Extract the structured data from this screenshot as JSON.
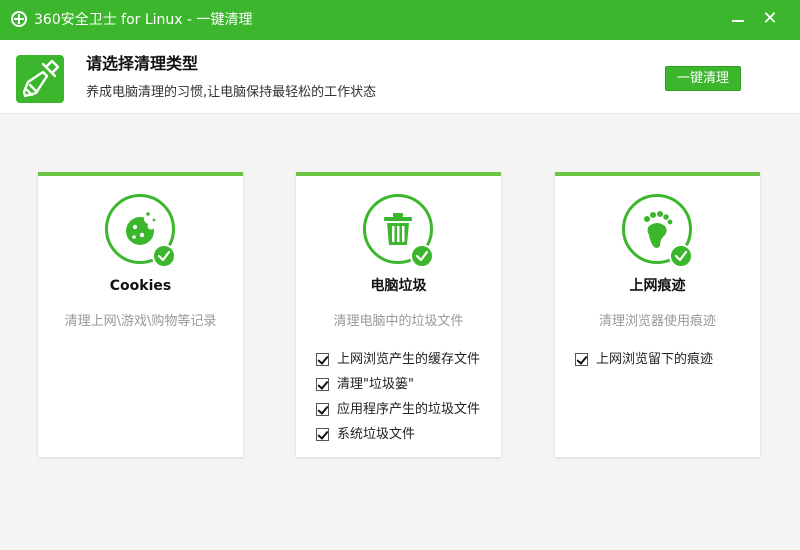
{
  "window": {
    "title": "360安全卫士 for Linux - 一键清理",
    "minimize_glyph": "—",
    "close_glyph": "✕"
  },
  "header": {
    "heading": "请选择清理类型",
    "subtitle": "养成电脑清理的习惯,让电脑保持最轻松的工作状态",
    "clean_button": "一键清理",
    "icon": "broom-icon"
  },
  "colors": {
    "accent": "#3cb62d",
    "card_top": "#6cc241",
    "desc_gray": "#999999"
  },
  "cards": [
    {
      "title": "Cookies",
      "description": "清理上网\\游戏\\购物等记录",
      "icon": "cookie-icon",
      "checked": true,
      "options": []
    },
    {
      "title": "电脑垃圾",
      "description": "清理电脑中的垃圾文件",
      "icon": "trash-icon",
      "checked": true,
      "options": [
        {
          "label": "上网浏览产生的缓存文件",
          "checked": true
        },
        {
          "label": "清理\"垃圾篓\"",
          "checked": true
        },
        {
          "label": "应用程序产生的垃圾文件",
          "checked": true
        },
        {
          "label": "系统垃圾文件",
          "checked": true
        }
      ]
    },
    {
      "title": "上网痕迹",
      "description": "清理浏览器使用痕迹",
      "icon": "footprint-icon",
      "checked": true,
      "options": [
        {
          "label": "上网浏览留下的痕迹",
          "checked": true
        }
      ]
    }
  ]
}
